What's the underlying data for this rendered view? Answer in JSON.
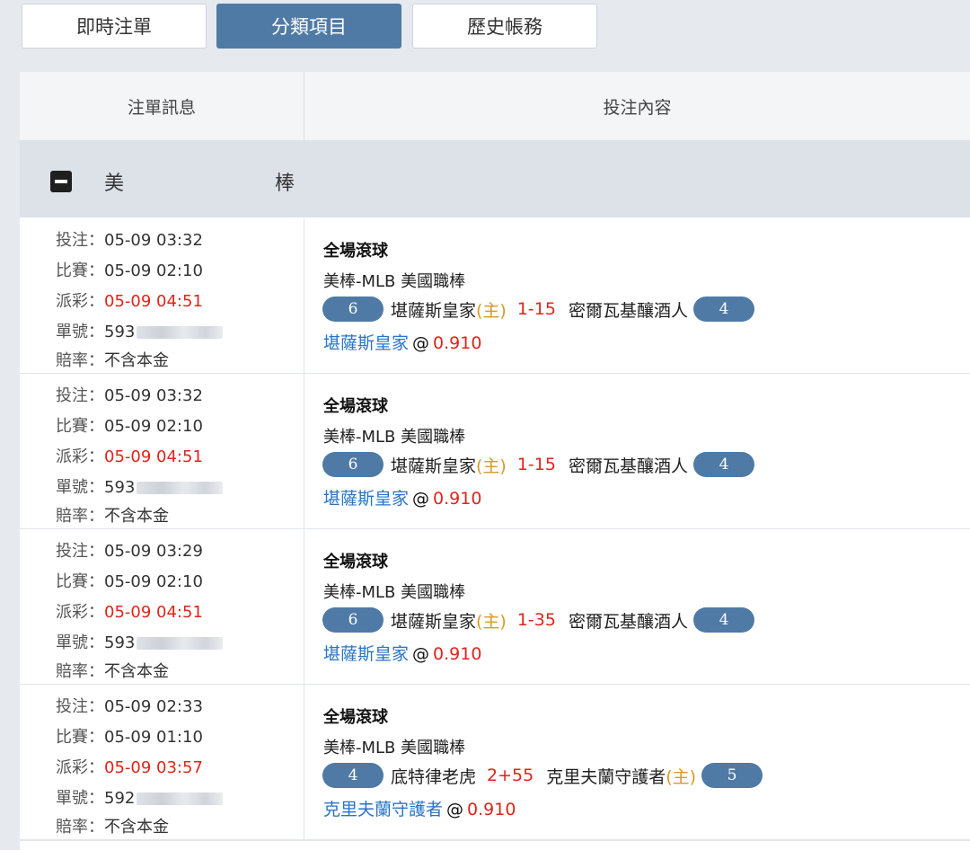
{
  "tabs": [
    {
      "label": "即時注單",
      "active": false
    },
    {
      "label": "分類項目",
      "active": true
    },
    {
      "label": "歷史帳務",
      "active": false
    }
  ],
  "table": {
    "headers": {
      "info": "注單訊息",
      "content": "投注內容"
    }
  },
  "group": {
    "title_char1": "美",
    "title_char2": "棒"
  },
  "labels": {
    "bet": "投注：",
    "match": "比賽：",
    "settle": "派彩：",
    "order": "單號：",
    "odds": "賠率：",
    "odds_value": "不含本金",
    "at": "@",
    "home_mark": "(主)"
  },
  "bets": [
    {
      "bet_time": "05-09 03:32",
      "match_time": "05-09 02:10",
      "settle_time": "05-09 04:51",
      "order_prefix": "593",
      "type": "全場滾球",
      "league": "美棒-MLB 美國職棒",
      "home_pill": "6",
      "team_a": "堪薩斯皇家",
      "team_a_home": true,
      "score": "1-15",
      "team_b": "密爾瓦基釀酒人",
      "team_b_home": false,
      "away_pill": "4",
      "pick_team": "堪薩斯皇家",
      "pick_odds": "0.910"
    },
    {
      "bet_time": "05-09 03:32",
      "match_time": "05-09 02:10",
      "settle_time": "05-09 04:51",
      "order_prefix": "593",
      "type": "全場滾球",
      "league": "美棒-MLB 美國職棒",
      "home_pill": "6",
      "team_a": "堪薩斯皇家",
      "team_a_home": true,
      "score": "1-15",
      "team_b": "密爾瓦基釀酒人",
      "team_b_home": false,
      "away_pill": "4",
      "pick_team": "堪薩斯皇家",
      "pick_odds": "0.910"
    },
    {
      "bet_time": "05-09 03:29",
      "match_time": "05-09 02:10",
      "settle_time": "05-09 04:51",
      "order_prefix": "593",
      "type": "全場滾球",
      "league": "美棒-MLB 美國職棒",
      "home_pill": "6",
      "team_a": "堪薩斯皇家",
      "team_a_home": true,
      "score": "1-35",
      "team_b": "密爾瓦基釀酒人",
      "team_b_home": false,
      "away_pill": "4",
      "pick_team": "堪薩斯皇家",
      "pick_odds": "0.910"
    },
    {
      "bet_time": "05-09 02:33",
      "match_time": "05-09 01:10",
      "settle_time": "05-09 03:57",
      "order_prefix": "592",
      "type": "全場滾球",
      "league": "美棒-MLB 美國職棒",
      "home_pill": "4",
      "team_a": "底特律老虎",
      "team_a_home": false,
      "score": "2+55",
      "team_b": "克里夫蘭守護者",
      "team_b_home": true,
      "away_pill": "5",
      "pick_team": "克里夫蘭守護者",
      "pick_odds": "0.910"
    }
  ],
  "colors": {
    "accent": "#4f7aa5",
    "red": "#e0241a",
    "home": "#d89a22",
    "pick": "#2a74c7"
  },
  "icons": {
    "group_toggle": "minus-square-icon"
  }
}
